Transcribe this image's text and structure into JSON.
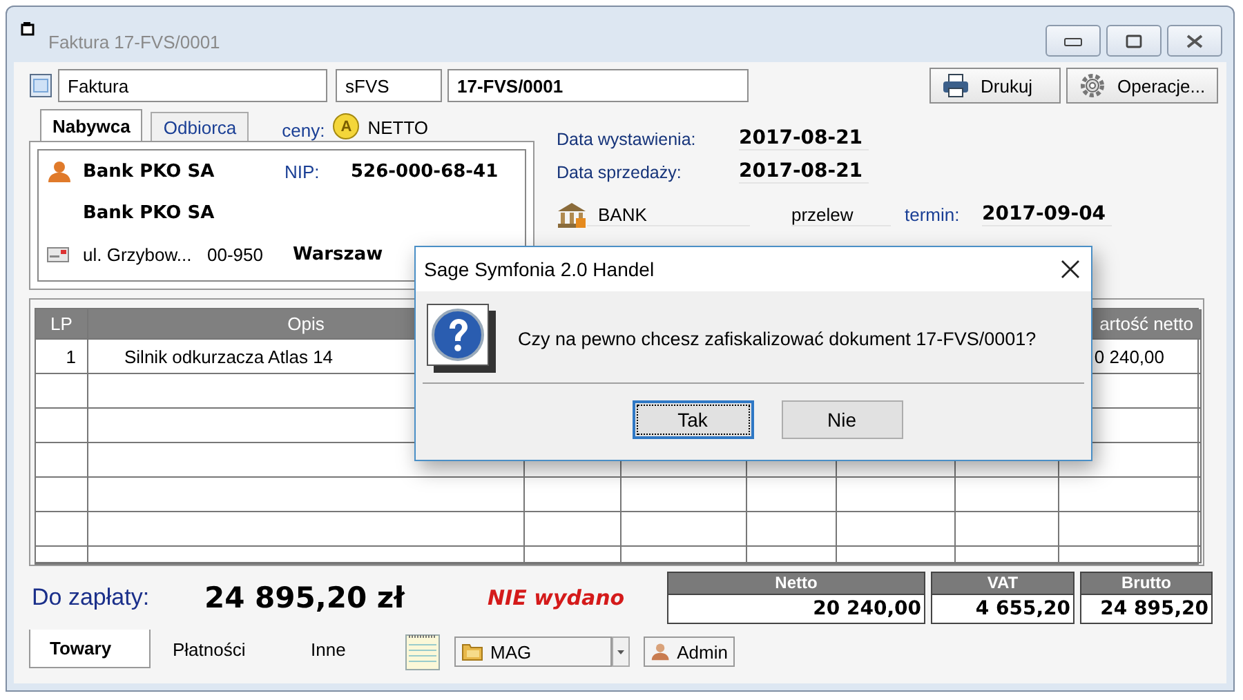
{
  "window": {
    "title": "Faktura 17-FVS/0001"
  },
  "header": {
    "doc_type": "Faktura",
    "series": "sFVS",
    "number": "17-FVS/0001",
    "buttons": [
      {
        "label": "Drukuj",
        "kind": "print"
      },
      {
        "label": "Operacje...",
        "kind": "gear"
      }
    ]
  },
  "party": {
    "tabs": [
      {
        "label": "Nabywca",
        "selected": true
      },
      {
        "label": "Odbiorca",
        "selected": false
      }
    ],
    "price_label": "ceny:",
    "price_badge": "A",
    "price_mode": "NETTO",
    "name": "Bank PKO SA",
    "nip_label": "NIP:",
    "nip": "526-000-68-41",
    "name2": "Bank PKO SA",
    "street": "ul. Grzybow...",
    "postal_code": "00-950",
    "city": "Warszaw"
  },
  "dates": {
    "issue_label": "Data wystawienia:",
    "issue": "2017-08-21",
    "sale_label": "Data sprzedaży:",
    "sale": "2017-08-21",
    "bank": "BANK",
    "payment": "przelew",
    "due_label": "termin:",
    "due": "2017-09-04"
  },
  "table": {
    "columns": [
      "LP",
      "Opis",
      "artość netto"
    ],
    "rows": [
      {
        "lp": "1",
        "description": "Silnik odkurzacza Atlas 14",
        "net_value": "0 240,00"
      }
    ]
  },
  "totals": {
    "label": "Do zapłaty:",
    "amount": "24 895,20 zł",
    "status": "NIE wydano",
    "summary": [
      {
        "label": "Netto",
        "value": "20 240,00"
      },
      {
        "label": "VAT",
        "value": "4 655,20"
      },
      {
        "label": "Brutto",
        "value": "24 895,20"
      }
    ]
  },
  "bottom_tabs": [
    {
      "label": "Towary",
      "selected": true
    },
    {
      "label": "Płatności",
      "selected": false
    },
    {
      "label": "Inne",
      "selected": false
    }
  ],
  "warehouse": "MAG",
  "user": "Admin",
  "dialog": {
    "title": "Sage Symfonia 2.0 Handel",
    "message": "Czy na pewno chcesz zafiskalizować dokument 17-FVS/0001?",
    "buttons": [
      {
        "label": "Tak",
        "focused": true
      },
      {
        "label": "Nie",
        "focused": false
      }
    ]
  }
}
